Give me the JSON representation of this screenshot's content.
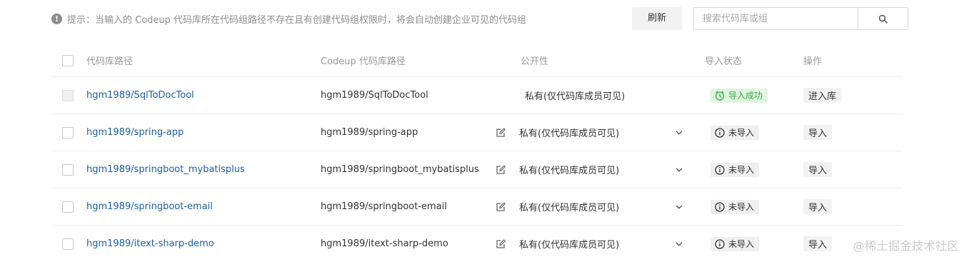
{
  "tip": {
    "icon": "exclamation-circle-icon",
    "text": "提示：当输入的 Codeup 代码库所在代码组路径不存在且有创建代码组权限时，将会自动创建企业可见的代码组"
  },
  "toolbar": {
    "refresh_label": "刷新",
    "search_placeholder": "搜索代码库或组",
    "search_icon": "search-icon"
  },
  "table": {
    "columns": {
      "path": "代码库路径",
      "codeup_path": "Codeup 代码库路径",
      "visibility": "公开性",
      "status": "导入状态",
      "action": "操作"
    },
    "rows": [
      {
        "path": "hgm1989/SqlToDocTool",
        "codeup_path": "hgm1989/SqlToDocTool",
        "visibility": "私有(仅代码库成员可见)",
        "status": "导入成功",
        "status_type": "success",
        "action": "进入库",
        "checkbox_disabled": true,
        "editable": false
      },
      {
        "path": "hgm1989/spring-app",
        "codeup_path": "hgm1989/spring-app",
        "visibility": "私有(仅代码库成员可见)",
        "status": "未导入",
        "status_type": "pending",
        "action": "导入",
        "checkbox_disabled": false,
        "editable": true
      },
      {
        "path": "hgm1989/springboot_mybatisplus",
        "codeup_path": "hgm1989/springboot_mybatisplus",
        "visibility": "私有(仅代码库成员可见)",
        "status": "未导入",
        "status_type": "pending",
        "action": "导入",
        "checkbox_disabled": false,
        "editable": true
      },
      {
        "path": "hgm1989/springboot-email",
        "codeup_path": "hgm1989/springboot-email",
        "visibility": "私有(仅代码库成员可见)",
        "status": "未导入",
        "status_type": "pending",
        "action": "导入",
        "checkbox_disabled": false,
        "editable": true
      },
      {
        "path": "hgm1989/itext-sharp-demo",
        "codeup_path": "hgm1989/itext-sharp-demo",
        "visibility": "私有(仅代码库成员可见)",
        "status": "未导入",
        "status_type": "pending",
        "action": "导入",
        "checkbox_disabled": false,
        "editable": true
      }
    ]
  },
  "watermark": "@稀土掘金技术社区",
  "colors": {
    "link": "#1b5fa8",
    "success_bg": "#dff5df",
    "success_text": "#3bab4a",
    "muted_text": "#999999"
  }
}
